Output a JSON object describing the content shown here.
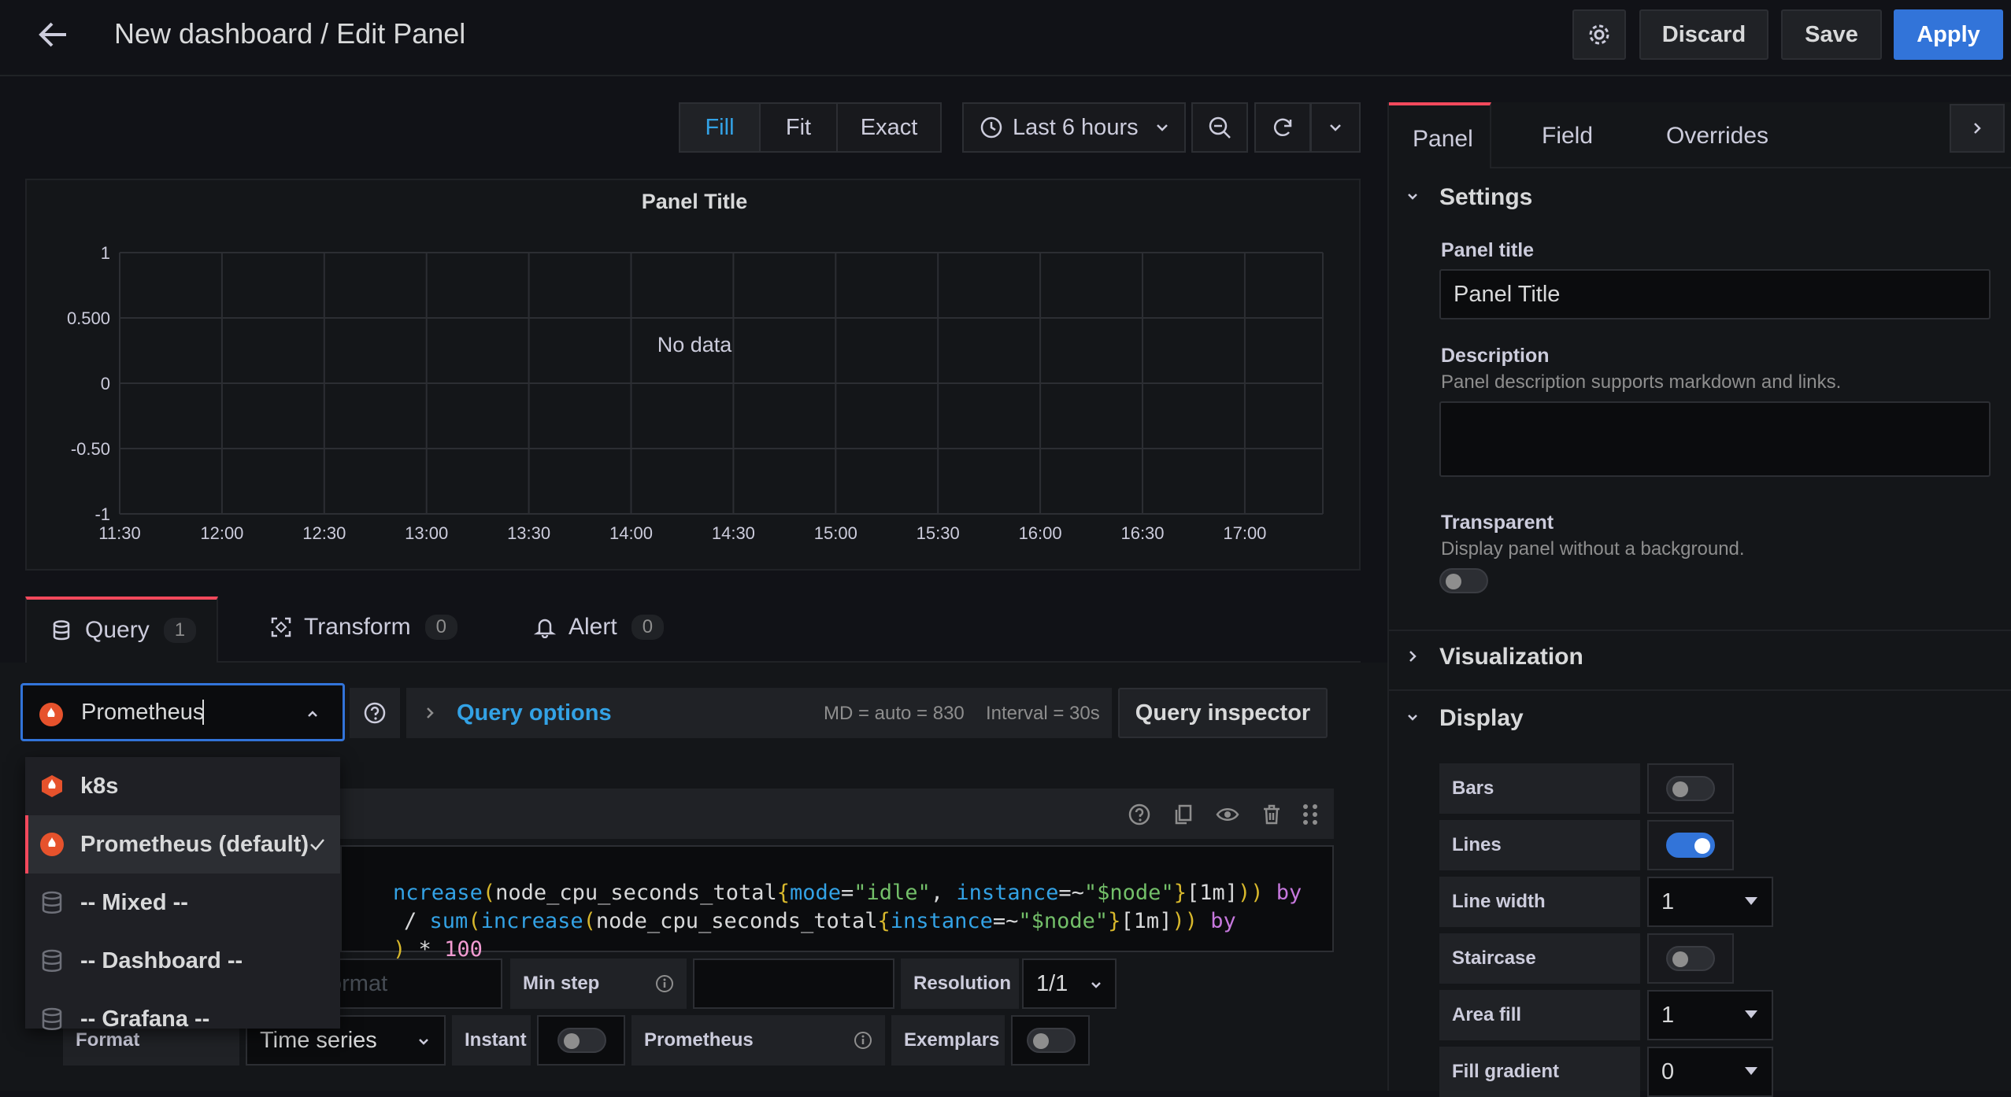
{
  "header": {
    "title": "New dashboard / Edit Panel",
    "discard_label": "Discard",
    "save_label": "Save",
    "apply_label": "Apply"
  },
  "toolbar": {
    "fill_label": "Fill",
    "fit_label": "Fit",
    "exact_label": "Exact",
    "time_range": "Last 6 hours"
  },
  "panel": {
    "title": "Panel Title",
    "no_data": "No data",
    "y_ticks": [
      "1",
      "0.500",
      "0",
      "-0.50",
      "-1"
    ],
    "x_ticks": [
      "11:30",
      "12:00",
      "12:30",
      "13:00",
      "13:30",
      "14:00",
      "14:30",
      "15:00",
      "15:30",
      "16:00",
      "16:30",
      "17:00"
    ]
  },
  "query_tabs": {
    "query_label": "Query",
    "query_count": "1",
    "transform_label": "Transform",
    "transform_count": "0",
    "alert_label": "Alert",
    "alert_count": "0"
  },
  "datasource": {
    "value": "Prometheus",
    "options": [
      {
        "label": "k8s"
      },
      {
        "label": "Prometheus (default)"
      },
      {
        "label": "-- Mixed --"
      },
      {
        "label": "-- Dashboard --"
      },
      {
        "label": "-- Grafana --"
      }
    ]
  },
  "query_options": {
    "label": "Query options",
    "md": "MD = auto = 830",
    "interval": "Interval = 30s",
    "inspector_label": "Query inspector"
  },
  "query_editor": {
    "line1": "ncrease(node_cpu_seconds_total{mode=\"idle\", instance=~\"$node\"}[1m])) by",
    "line2": "/ sum(increase(node_cpu_seconds_total{instance=~\"$node\"}[1m])) by",
    "line3": ") * 100",
    "legend_placeholder": "ormat",
    "min_step_label": "Min step",
    "resolution_label": "Resolution",
    "resolution_value": "1/1",
    "format_label": "Format",
    "format_value": "Time series",
    "instant_label": "Instant",
    "prometheus_label": "Prometheus",
    "exemplars_label": "Exemplars"
  },
  "right_pane": {
    "tabs": [
      "Panel",
      "Field",
      "Overrides"
    ],
    "settings_label": "Settings",
    "panel_title_label": "Panel title",
    "panel_title_value": "Panel Title",
    "description_label": "Description",
    "description_help": "Panel description supports markdown and links.",
    "transparent_label": "Transparent",
    "transparent_help": "Display panel without a background.",
    "visualization_label": "Visualization",
    "display_label": "Display",
    "options": {
      "bars": "Bars",
      "lines": "Lines",
      "line_width": "Line width",
      "line_width_value": "1",
      "staircase": "Staircase",
      "area_fill": "Area fill",
      "area_fill_value": "1",
      "fill_gradient": "Fill gradient",
      "fill_gradient_value": "0"
    }
  },
  "colors": {
    "accent": "#3274d9",
    "link": "#33a2e5",
    "tab_active_gradient": "#f2495c"
  }
}
